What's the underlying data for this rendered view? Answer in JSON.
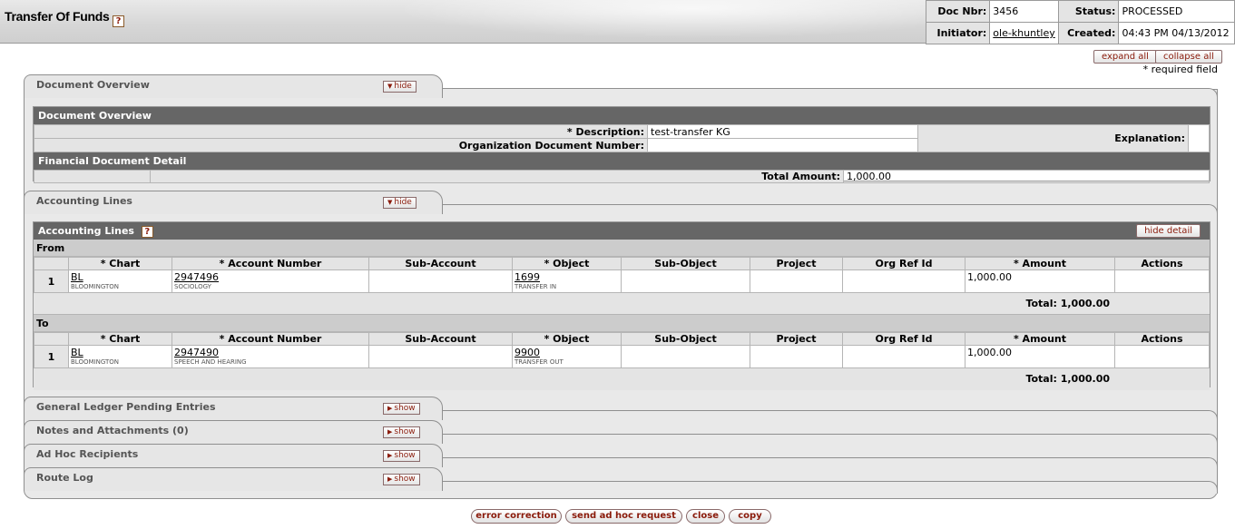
{
  "header": {
    "title": "Transfer Of Funds",
    "help": "?",
    "doc_nbr_label": "Doc Nbr:",
    "doc_nbr": "3456",
    "status_label": "Status:",
    "status": "PROCESSED",
    "initiator_label": "Initiator:",
    "initiator": "ole-khuntley",
    "created_label": "Created:",
    "created": "04:43 PM 04/13/2012"
  },
  "top_buttons": {
    "expand_all": "expand all",
    "collapse_all": "collapse all"
  },
  "required_note": "* required field",
  "tabs": {
    "document_overview": {
      "title": "Document Overview",
      "toggle": "hide"
    },
    "accounting_lines": {
      "title": "Accounting Lines",
      "toggle": "hide"
    },
    "gl_pending": {
      "title": "General Ledger Pending Entries",
      "toggle": "show"
    },
    "notes": {
      "title": "Notes and Attachments (0)",
      "toggle": "show"
    },
    "adhoc": {
      "title": "Ad Hoc Recipients",
      "toggle": "show"
    },
    "route_log": {
      "title": "Route Log",
      "toggle": "show"
    }
  },
  "document_overview": {
    "section_title": "Document Overview",
    "description_label": "* Description:",
    "description": "test-transfer KG",
    "org_doc_number_label": "Organization Document Number:",
    "org_doc_number": "",
    "explanation_label": "Explanation:",
    "explanation": "",
    "financial_title": "Financial Document Detail",
    "total_amount_label": "Total Amount:",
    "total_amount": "1,000.00"
  },
  "accounting_lines": {
    "section_title": "Accounting Lines",
    "help": "?",
    "hide_detail": "hide detail",
    "columns": [
      "* Chart",
      "* Account Number",
      "Sub-Account",
      "* Object",
      "Sub-Object",
      "Project",
      "Org Ref Id",
      "* Amount",
      "Actions"
    ],
    "from": {
      "label": "From",
      "row": {
        "num": "1",
        "chart": "BL",
        "chart_name": "BLOOMINGTON",
        "account": "2947496",
        "account_name": "SOCIOLOGY",
        "sub_account": "",
        "object": "1699",
        "object_name": "TRANSFER IN",
        "sub_object": "",
        "project": "",
        "org_ref_id": "",
        "amount": "1,000.00",
        "actions": ""
      },
      "total": "Total: 1,000.00"
    },
    "to": {
      "label": "To",
      "row": {
        "num": "1",
        "chart": "BL",
        "chart_name": "BLOOMINGTON",
        "account": "2947490",
        "account_name": "SPEECH AND HEARING",
        "sub_account": "",
        "object": "9900",
        "object_name": "TRANSFER OUT",
        "sub_object": "",
        "project": "",
        "org_ref_id": "",
        "amount": "1,000.00",
        "actions": ""
      },
      "total": "Total: 1,000.00"
    }
  },
  "bottom_buttons": {
    "error_correction": "error correction",
    "send_adhoc": "send ad hoc request",
    "close": "close",
    "copy": "copy"
  }
}
